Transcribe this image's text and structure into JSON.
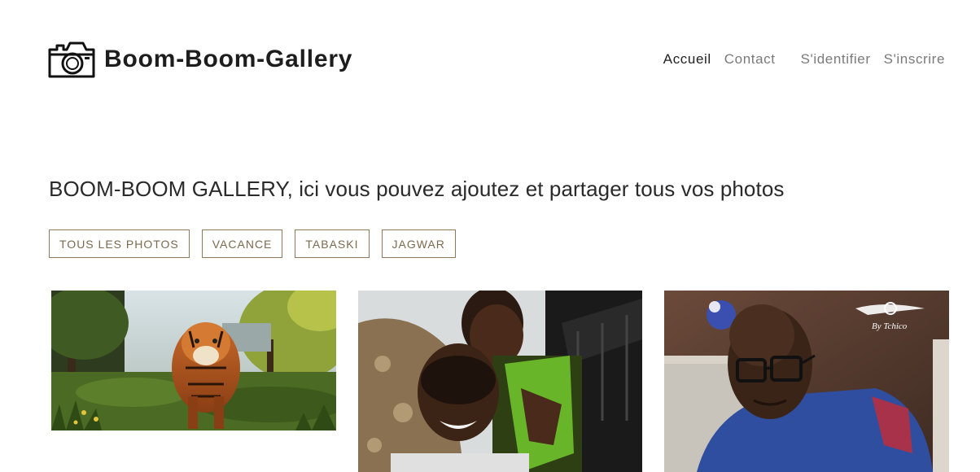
{
  "brand": {
    "name": "Boom-Boom-Gallery",
    "icon": "camera-icon"
  },
  "nav": {
    "main": [
      {
        "label": "Accueil",
        "active": true
      },
      {
        "label": "Contact",
        "active": false
      }
    ],
    "auth": [
      {
        "label": "S'identifier"
      },
      {
        "label": "S'inscrire"
      }
    ]
  },
  "hero": {
    "headline": "BOOM-BOOM GALLERY, ici vous pouvez ajoutez et partager tous vos photos"
  },
  "filters": [
    "TOUS LES PHOTOS",
    "VACANCE",
    "TABASKI",
    "JAGWAR"
  ],
  "gallery": {
    "photos": [
      {
        "subject": "tiger in a forest"
      },
      {
        "subject": "two smiling friends on a couch"
      },
      {
        "subject": "man with glasses in blue shirt",
        "watermark": "By Tchico"
      }
    ]
  },
  "colors": {
    "accent_border": "#8e7a5a",
    "accent_text": "#7b6a4e",
    "nav_inactive": "#7a7a7a",
    "nav_active": "#222222"
  }
}
